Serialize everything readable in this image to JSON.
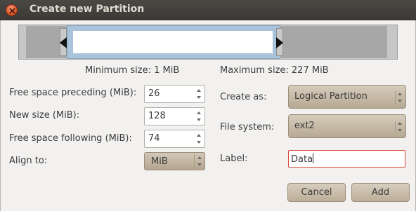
{
  "window": {
    "title": "Create new Partition"
  },
  "sizes": {
    "minimum": "Minimum size: 1 MiB",
    "maximum": "Maximum size: 227 MiB"
  },
  "fields": {
    "free_preceding": {
      "label": "Free space preceding (MiB):",
      "value": "26"
    },
    "new_size": {
      "label": "New size (MiB):",
      "value": "128"
    },
    "free_following": {
      "label": "Free space following (MiB):",
      "value": "74"
    },
    "align_to": {
      "label": "Align to:",
      "value": "MiB"
    },
    "create_as": {
      "label": "Create as:",
      "value": "Logical Partition"
    },
    "file_system": {
      "label": "File system:",
      "value": "ext2"
    },
    "partition_label": {
      "label": "Label:",
      "value": "Data"
    }
  },
  "buttons": {
    "cancel": "Cancel",
    "add": "Add"
  },
  "icons": {
    "close": "close-icon",
    "left_handle": "resize-left-arrow-icon",
    "right_handle": "resize-right-arrow-icon",
    "spin": "spin-up-down-icon",
    "combo": "combo-up-down-icon"
  },
  "colors": {
    "titlebar": "#3b3a36",
    "close": "#e1572c",
    "partition": "#a9c3dc",
    "accent_border": "#d9483b"
  }
}
